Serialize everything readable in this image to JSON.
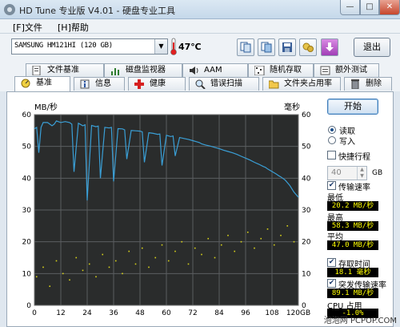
{
  "window": {
    "title": "HD Tune 专业版 V4.01 - 硬盘专业工具",
    "min": "—",
    "max": "□",
    "close": "✕"
  },
  "menu": [
    "[F]文件",
    "[H]帮助"
  ],
  "toolbar": {
    "drive": "SAMSUNG HM121HI (120 GB)",
    "temperature": "47℃",
    "exit": "退出",
    "icons": [
      "copy-text-icon",
      "copy-screenshot-icon",
      "save-icon",
      "options-icon",
      "download-icon"
    ]
  },
  "tabs": {
    "row1": [
      {
        "label": "文件基准",
        "icon": "file-benchmark-icon"
      },
      {
        "label": "磁盘监视器",
        "icon": "disk-monitor-icon"
      },
      {
        "label": "AAM",
        "icon": "speaker-icon"
      },
      {
        "label": "随机存取",
        "icon": "random-access-icon"
      },
      {
        "label": "额外测试",
        "icon": "extra-tests-icon"
      }
    ],
    "row2": [
      {
        "label": "基准",
        "icon": "benchmark-icon"
      },
      {
        "label": "信息",
        "icon": "info-icon"
      },
      {
        "label": "健康",
        "icon": "health-icon"
      },
      {
        "label": "错误扫描",
        "icon": "error-scan-icon"
      },
      {
        "label": "文件夹占用率",
        "icon": "folder-usage-icon"
      },
      {
        "label": "删除",
        "icon": "erase-icon"
      }
    ],
    "active": "基准"
  },
  "controls": {
    "start": "开始",
    "read": "读取",
    "write": "写入",
    "mode_selected": "read",
    "short_stroke": "快捷行程",
    "short_stroke_value": "40",
    "short_stroke_unit": "GB",
    "transfer_rate": "传输速率",
    "min_label": "最低",
    "min_value": "20.2 MB/秒",
    "max_label": "最高",
    "max_value": "58.3 MB/秒",
    "avg_label": "平均",
    "avg_value": "47.0 MB/秒",
    "access_time": "存取时间",
    "access_value": "18.1 毫秒",
    "burst_rate": "突发传输速率",
    "burst_value": "89.1 MB/秒",
    "cpu_label": "CPU 占用",
    "cpu_value": "-1.0%"
  },
  "colors": {
    "plot_bg": "#2a2c2c",
    "grid": "#5b5e60",
    "transfer_line": "#3a9fd6",
    "access_points": "#d8d21a",
    "readout_text": "#ffff00"
  },
  "watermark": "泡泡网 PCPOP.COM",
  "chart_data": {
    "type": "line",
    "xlabel": "",
    "x_unit": "GB",
    "ylabel_left": "MB/秒",
    "ylabel_right": "毫秒",
    "xlim": [
      0,
      120
    ],
    "ylim_left": [
      0,
      60
    ],
    "ylim_right": [
      0,
      60
    ],
    "x_ticks": [
      0,
      12,
      24,
      36,
      48,
      60,
      72,
      84,
      96,
      108,
      120
    ],
    "x_tick_labels": [
      "0",
      "12",
      "24",
      "36",
      "48",
      "60",
      "72",
      "84",
      "96",
      "108",
      "120GB"
    ],
    "y_ticks_left": [
      0,
      10,
      20,
      30,
      40,
      50,
      60
    ],
    "y_ticks_right": [
      0,
      10,
      20,
      30,
      40,
      50,
      60
    ],
    "grid": true,
    "series": [
      {
        "name": "传输速率",
        "axis": "left",
        "x": [
          0,
          1,
          2,
          3,
          4,
          6,
          8,
          9,
          10,
          12,
          14,
          16,
          17,
          18,
          20,
          22,
          23,
          24,
          26,
          28,
          29,
          30,
          32,
          34,
          35,
          36,
          38,
          40,
          41,
          42,
          44,
          46,
          48,
          49,
          50,
          52,
          54,
          56,
          57,
          58,
          60,
          62,
          63,
          64,
          66,
          68,
          70,
          72,
          74,
          75,
          76,
          78,
          80,
          82,
          84,
          86,
          88,
          90,
          92,
          94,
          96,
          98,
          100,
          102,
          104,
          105,
          106,
          108,
          110,
          111,
          112,
          114,
          116,
          118,
          120
        ],
        "y": [
          55.5,
          56,
          48,
          56,
          57.5,
          57.5,
          56.5,
          57,
          58,
          57.5,
          57.8,
          57.5,
          57,
          42,
          57.3,
          56.5,
          56.8,
          33,
          56.6,
          56.2,
          56.4,
          40,
          56,
          55.8,
          56,
          39,
          55.6,
          55.5,
          55.2,
          46,
          55,
          54.9,
          54.8,
          54.6,
          45,
          54.3,
          54.1,
          53.8,
          53.9,
          44,
          53.5,
          53.1,
          53.3,
          47,
          52.8,
          52.5,
          52.2,
          51.8,
          51.4,
          51.2,
          50.8,
          50.4,
          50.1,
          49.7,
          49.3,
          48.8,
          48.4,
          48,
          47.5,
          46.9,
          46.3,
          45.7,
          45,
          44.4,
          43.7,
          43.4,
          42.9,
          42.1,
          41.3,
          40.8,
          40.4,
          39.4,
          37.8,
          35.6,
          34
        ]
      },
      {
        "name": "存取时间",
        "axis": "right",
        "type": "scatter",
        "distribution": "dense band from about 2–17 ms at 0 GB rising to about 10–26 ms at 120 GB",
        "x": [
          1,
          4,
          7,
          10,
          13,
          16,
          19,
          22,
          25,
          28,
          31,
          34,
          37,
          40,
          43,
          46,
          49,
          52,
          55,
          58,
          61,
          64,
          67,
          70,
          73,
          76,
          79,
          82,
          85,
          88,
          91,
          94,
          97,
          100,
          103,
          106,
          109,
          112,
          115,
          118
        ],
        "y": [
          9,
          12,
          6,
          14,
          10,
          8,
          15,
          11,
          13,
          9,
          16,
          12,
          14,
          10,
          17,
          13,
          18,
          12,
          15,
          19,
          14,
          17,
          20,
          13,
          18,
          16,
          21,
          15,
          19,
          22,
          17,
          20,
          23,
          18,
          21,
          24,
          19,
          22,
          25,
          20
        ]
      }
    ]
  }
}
